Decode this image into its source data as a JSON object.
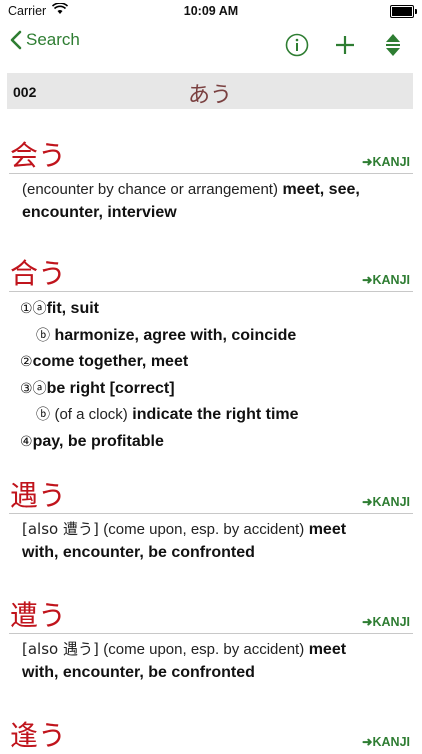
{
  "status": {
    "carrier": "Carrier",
    "time": "10:09 AM"
  },
  "nav": {
    "back_label": "Search"
  },
  "header": {
    "number": "002",
    "reading": "あう"
  },
  "entries": [
    {
      "headword": "会う",
      "kanji_link": "➜KANJI",
      "note": "(encounter by chance or arrangement)",
      "gloss": "meet, see, encounter, interview"
    },
    {
      "headword": "合う",
      "kanji_link": "➜KANJI",
      "senses": [
        {
          "marker": "①ⓐ",
          "text": "fit, suit"
        },
        {
          "marker": "ⓑ",
          "text": "harmonize, agree with, coincide"
        },
        {
          "marker": "②",
          "text": "come together, meet"
        },
        {
          "marker": "③ⓐ",
          "text": "be right [correct]"
        },
        {
          "marker": "ⓑ",
          "note": "(of a clock)",
          "text": "indicate the right time"
        },
        {
          "marker": "④",
          "text": "pay, be profitable"
        }
      ]
    },
    {
      "headword": "遇う",
      "kanji_link": "➜KANJI",
      "also": "[also 遭う]",
      "note": "(come upon, esp. by accident)",
      "gloss_1": "meet",
      "gloss_2": "with, encounter, be confronted"
    },
    {
      "headword": "遭う",
      "kanji_link": "➜KANJI",
      "also": "[also 遇う]",
      "note": "(come upon, esp. by accident)",
      "gloss_1": "meet",
      "gloss_2": "with, encounter, be confronted"
    },
    {
      "headword": "逢う",
      "kanji_link": "➜KANJI"
    }
  ]
}
